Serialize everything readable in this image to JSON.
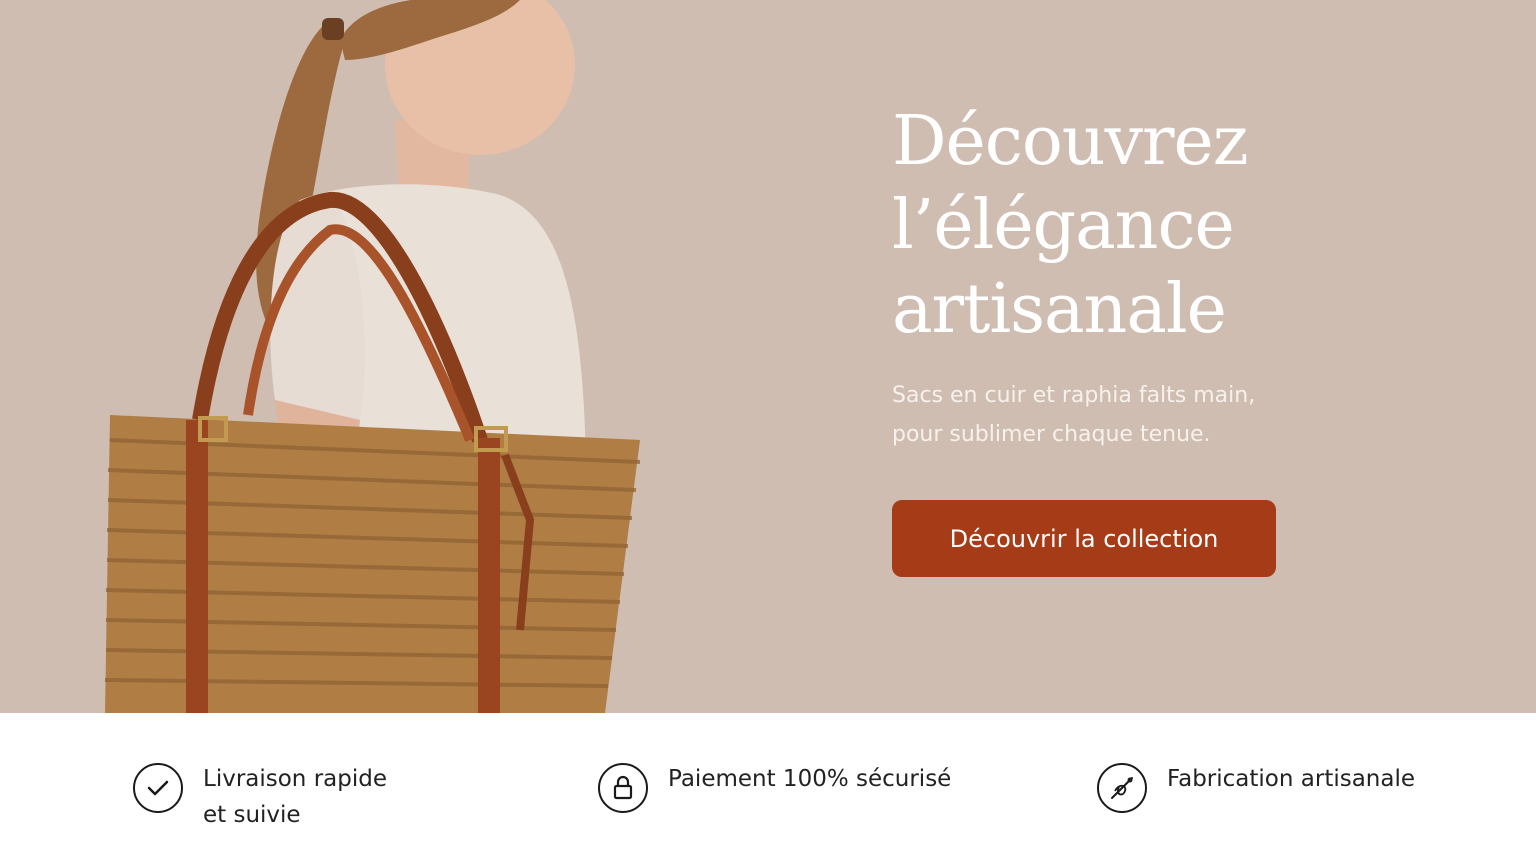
{
  "hero": {
    "headline_lines": [
      "Découvrez",
      "l’élégance",
      "artisanale"
    ],
    "subhead_lines": [
      "Sacs en cuir et raphia falts main,",
      "pour sublimer chaque tenue."
    ],
    "cta_label": "Découvrir la collection",
    "image_icon": "woman-with-woven-tote-photo"
  },
  "features": [
    {
      "icon": "check-circle-icon",
      "lines": [
        "Livraison rapide",
        "et suivie"
      ]
    },
    {
      "icon": "lock-icon",
      "lines": [
        "Paiement 100% sécurisé"
      ]
    },
    {
      "icon": "needle-thread-icon",
      "lines": [
        "Fabrication artisanale"
      ]
    }
  ],
  "colors": {
    "hero_bg": "#cfbdb1",
    "accent": "#a63b17",
    "text_dark": "#222222",
    "white": "#ffffff"
  }
}
